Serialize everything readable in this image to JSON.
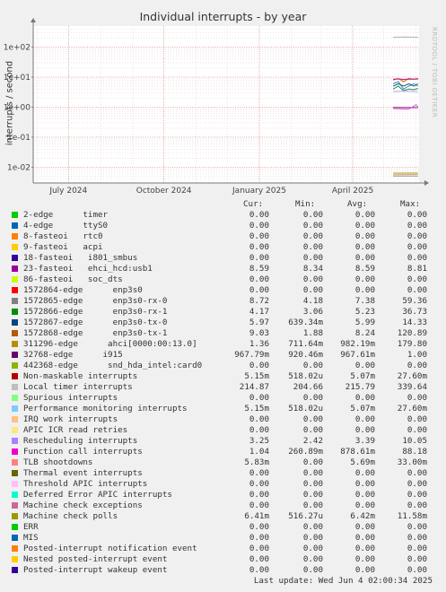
{
  "title": "Individual interrupts - by year",
  "watermark": "RRDTOOL / TOBI OETIKER",
  "footer": "Last update: Wed Jun  4 02:00:34 2025",
  "legend_headers": {
    "cur": "Cur:",
    "min": "Min:",
    "avg": "Avg:",
    "max": "Max:"
  },
  "chart_data": {
    "type": "line",
    "ylabel": "interrupts / second",
    "yscale": "log",
    "ylim": [
      0.003,
      500
    ],
    "y_ticks": [
      {
        "value": 0.01,
        "label": "1e-02"
      },
      {
        "value": 0.1,
        "label": "1e-01"
      },
      {
        "value": 1,
        "label": "1e+00"
      },
      {
        "value": 10,
        "label": "1e+01"
      },
      {
        "value": 100,
        "label": "1e+02"
      }
    ],
    "x_ticks": [
      {
        "date": "2024-07-01",
        "label": "July 2024"
      },
      {
        "date": "2024-10-01",
        "label": "October 2024"
      },
      {
        "date": "2025-01-01",
        "label": "January 2025"
      },
      {
        "date": "2025-04-01",
        "label": "April 2025"
      }
    ],
    "xlim": [
      "2024-05-28",
      "2025-06-04"
    ],
    "grid": true,
    "series": [
      {
        "name": "Local timer interrupts",
        "color": "#b0b0b0",
        "points": [
          [
            "2025-05-10",
            210
          ],
          [
            "2025-05-20",
            215
          ],
          [
            "2025-06-03",
            212
          ]
        ]
      },
      {
        "name": "1572868-edge enp3s0-tx-1",
        "color": "#c86a10",
        "points": [
          [
            "2025-05-10",
            8
          ],
          [
            "2025-05-15",
            9
          ],
          [
            "2025-05-20",
            7
          ],
          [
            "2025-05-25",
            9
          ],
          [
            "2025-05-30",
            8.5
          ],
          [
            "2025-06-03",
            9
          ]
        ]
      },
      {
        "name": "23-fasteoi ehci_hcd:usb1",
        "color": "#b0177e",
        "points": [
          [
            "2025-05-10",
            8.5
          ],
          [
            "2025-05-15",
            8.7
          ],
          [
            "2025-05-20",
            8.4
          ],
          [
            "2025-05-25",
            8.6
          ],
          [
            "2025-05-30",
            8.5
          ],
          [
            "2025-06-03",
            8.6
          ]
        ]
      },
      {
        "name": "1572864-edge enp3s0",
        "color": "#3a8ccc",
        "points": [
          [
            "2025-05-10",
            6
          ],
          [
            "2025-05-15",
            7
          ],
          [
            "2025-05-20",
            4
          ],
          [
            "2025-05-25",
            5
          ],
          [
            "2025-05-30",
            6
          ],
          [
            "2025-06-03",
            5
          ]
        ]
      },
      {
        "name": "1572867-edge enp3s0-tx-0",
        "color": "#11607d",
        "points": [
          [
            "2025-05-10",
            5
          ],
          [
            "2025-05-15",
            6
          ],
          [
            "2025-05-20",
            5
          ],
          [
            "2025-05-25",
            6
          ],
          [
            "2025-05-30",
            5
          ],
          [
            "2025-06-03",
            6
          ]
        ]
      },
      {
        "name": "1572866-edge enp3s0-rx-1",
        "color": "#1c8a48",
        "points": [
          [
            "2025-05-10",
            4
          ],
          [
            "2025-05-15",
            5
          ],
          [
            "2025-05-20",
            3.5
          ],
          [
            "2025-05-25",
            4
          ],
          [
            "2025-05-30",
            3.8
          ],
          [
            "2025-06-03",
            4.2
          ]
        ]
      },
      {
        "name": "Rescheduling interrupts",
        "color": "#b9a0e8",
        "points": [
          [
            "2025-05-10",
            3.3
          ],
          [
            "2025-05-20",
            3.4
          ],
          [
            "2025-06-03",
            3.3
          ]
        ]
      },
      {
        "name": "32768-edge i915",
        "color": "#7a1a96",
        "points": [
          [
            "2025-05-10",
            0.97
          ],
          [
            "2025-05-20",
            0.97
          ],
          [
            "2025-05-28",
            0.96
          ],
          [
            "2025-06-03",
            0.97
          ]
        ]
      },
      {
        "name": "Function call interrupts",
        "color": "#e65cce",
        "points": [
          [
            "2025-05-10",
            0.9
          ],
          [
            "2025-05-25",
            0.85
          ],
          [
            "2025-06-01",
            1.2
          ],
          [
            "2025-06-03",
            1.04
          ]
        ]
      },
      {
        "name": "Non-maskable interrupts",
        "color": "#b01010",
        "points": [
          [
            "2025-05-10",
            0.0051
          ],
          [
            "2025-06-03",
            0.0051
          ]
        ]
      },
      {
        "name": "Performance monitoring interrupts",
        "color": "#8fcbe3",
        "points": [
          [
            "2025-05-10",
            0.0052
          ],
          [
            "2025-06-03",
            0.0052
          ]
        ]
      },
      {
        "name": "Machine check polls",
        "color": "#98a822",
        "points": [
          [
            "2025-05-10",
            0.0064
          ],
          [
            "2025-06-03",
            0.0064
          ]
        ]
      },
      {
        "name": "TLB shootdowns",
        "color": "#ffa060",
        "points": [
          [
            "2025-05-10",
            0.0057
          ],
          [
            "2025-06-03",
            0.0058
          ]
        ]
      },
      {
        "name": "311296-edge ahci[0000:00:13.0]",
        "color": "#d8b838",
        "points": [
          [
            "2025-05-10",
            0.001
          ],
          [
            "2025-06-03",
            0.001
          ]
        ]
      }
    ]
  },
  "legend": [
    {
      "name": "2-edge      timer",
      "color": "#00cc00",
      "cur": "0.00",
      "min": "0.00",
      "avg": "0.00",
      "max": "0.00"
    },
    {
      "name": "4-edge      ttyS0",
      "color": "#0066b3",
      "cur": "0.00",
      "min": "0.00",
      "avg": "0.00",
      "max": "0.00"
    },
    {
      "name": "8-fasteoi   rtc0",
      "color": "#ff8000",
      "cur": "0.00",
      "min": "0.00",
      "avg": "0.00",
      "max": "0.00"
    },
    {
      "name": "9-fasteoi   acpi",
      "color": "#ffcc00",
      "cur": "0.00",
      "min": "0.00",
      "avg": "0.00",
      "max": "0.00"
    },
    {
      "name": "18-fasteoi   i801_smbus",
      "color": "#330099",
      "cur": "0.00",
      "min": "0.00",
      "avg": "0.00",
      "max": "0.00"
    },
    {
      "name": "23-fasteoi   ehci_hcd:usb1",
      "color": "#990099",
      "cur": "8.59",
      "min": "8.34",
      "avg": "8.59",
      "max": "8.81"
    },
    {
      "name": "86-fasteoi   soc_dts",
      "color": "#ccff00",
      "cur": "0.00",
      "min": "0.00",
      "avg": "0.00",
      "max": "0.00"
    },
    {
      "name": "1572864-edge      enp3s0",
      "color": "#ff0000",
      "cur": "0.00",
      "min": "0.00",
      "avg": "0.00",
      "max": "0.00"
    },
    {
      "name": "1572865-edge      enp3s0-rx-0",
      "color": "#808080",
      "cur": "8.72",
      "min": "4.18",
      "avg": "7.38",
      "max": "59.36"
    },
    {
      "name": "1572866-edge      enp3s0-rx-1",
      "color": "#008f00",
      "cur": "4.17",
      "min": "3.06",
      "avg": "5.23",
      "max": "36.73"
    },
    {
      "name": "1572867-edge      enp3s0-tx-0",
      "color": "#00487d",
      "cur": "5.97",
      "min": "639.34m",
      "avg": "5.99",
      "max": "14.33"
    },
    {
      "name": "1572868-edge      enp3s0-tx-1",
      "color": "#b35a00",
      "cur": "9.03",
      "min": "1.88",
      "avg": "8.24",
      "max": "120.89"
    },
    {
      "name": "311296-edge      ahci[0000:00:13.0]",
      "color": "#b38f00",
      "cur": "1.36",
      "min": "711.64m",
      "avg": "982.19m",
      "max": "179.80"
    },
    {
      "name": "32768-edge      i915",
      "color": "#6b006b",
      "cur": "967.79m",
      "min": "920.46m",
      "avg": "967.61m",
      "max": "1.00"
    },
    {
      "name": "442368-edge      snd_hda_intel:card0",
      "color": "#8fb300",
      "cur": "0.00",
      "min": "0.00",
      "avg": "0.00",
      "max": "0.00"
    },
    {
      "name": "Non-maskable interrupts",
      "color": "#b30000",
      "cur": "5.15m",
      "min": "518.02u",
      "avg": "5.07m",
      "max": "27.60m"
    },
    {
      "name": "Local timer interrupts",
      "color": "#bebebe",
      "cur": "214.87",
      "min": "204.66",
      "avg": "215.79",
      "max": "339.64"
    },
    {
      "name": "Spurious interrupts",
      "color": "#80ff80",
      "cur": "0.00",
      "min": "0.00",
      "avg": "0.00",
      "max": "0.00"
    },
    {
      "name": "Performance monitoring interrupts",
      "color": "#80c9ff",
      "cur": "5.15m",
      "min": "518.02u",
      "avg": "5.07m",
      "max": "27.60m"
    },
    {
      "name": "IRQ work interrupts",
      "color": "#ffc080",
      "cur": "0.00",
      "min": "0.00",
      "avg": "0.00",
      "max": "0.00"
    },
    {
      "name": "APIC ICR read retries",
      "color": "#ffe680",
      "cur": "0.00",
      "min": "0.00",
      "avg": "0.00",
      "max": "0.00"
    },
    {
      "name": "Rescheduling interrupts",
      "color": "#aa80ff",
      "cur": "3.25",
      "min": "2.42",
      "avg": "3.39",
      "max": "10.05"
    },
    {
      "name": "Function call interrupts",
      "color": "#ee00cc",
      "cur": "1.04",
      "min": "260.89m",
      "avg": "878.61m",
      "max": "88.18"
    },
    {
      "name": "TLB shootdowns",
      "color": "#ff8080",
      "cur": "5.83m",
      "min": "0.00",
      "avg": "5.69m",
      "max": "33.00m"
    },
    {
      "name": "Thermal event interrupts",
      "color": "#666600",
      "cur": "0.00",
      "min": "0.00",
      "avg": "0.00",
      "max": "0.00"
    },
    {
      "name": "Threshold APIC interrupts",
      "color": "#ffbfff",
      "cur": "0.00",
      "min": "0.00",
      "avg": "0.00",
      "max": "0.00"
    },
    {
      "name": "Deferred Error APIC interrupts",
      "color": "#00ffcc",
      "cur": "0.00",
      "min": "0.00",
      "avg": "0.00",
      "max": "0.00"
    },
    {
      "name": "Machine check exceptions",
      "color": "#cc6699",
      "cur": "0.00",
      "min": "0.00",
      "avg": "0.00",
      "max": "0.00"
    },
    {
      "name": "Machine check polls",
      "color": "#999900",
      "cur": "6.41m",
      "min": "516.27u",
      "avg": "6.42m",
      "max": "11.58m"
    },
    {
      "name": "ERR",
      "color": "#00cc00",
      "cur": "0.00",
      "min": "0.00",
      "avg": "0.00",
      "max": "0.00"
    },
    {
      "name": "MIS",
      "color": "#0066b3",
      "cur": "0.00",
      "min": "0.00",
      "avg": "0.00",
      "max": "0.00"
    },
    {
      "name": "Posted-interrupt notification event",
      "color": "#ff8000",
      "cur": "0.00",
      "min": "0.00",
      "avg": "0.00",
      "max": "0.00"
    },
    {
      "name": "Nested posted-interrupt event",
      "color": "#ffcc00",
      "cur": "0.00",
      "min": "0.00",
      "avg": "0.00",
      "max": "0.00"
    },
    {
      "name": "Posted-interrupt wakeup event",
      "color": "#330099",
      "cur": "0.00",
      "min": "0.00",
      "avg": "0.00",
      "max": "0.00"
    }
  ]
}
